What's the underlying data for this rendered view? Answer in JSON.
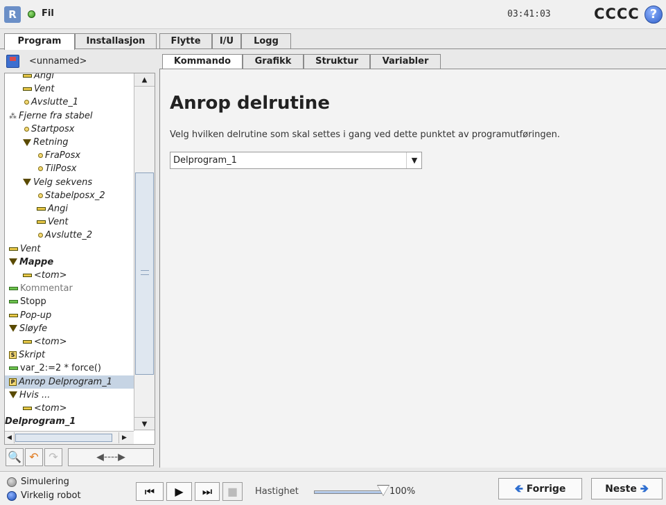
{
  "header": {
    "logo_text": "R",
    "file_menu": "Fil",
    "time": "03:41:03",
    "robot_name": "CCCC",
    "help_glyph": "?"
  },
  "main_tabs": [
    {
      "label": "Program",
      "active": true
    },
    {
      "label": "Installasjon",
      "active": false
    },
    {
      "label": "Flytte",
      "active": false
    },
    {
      "label": "I/U",
      "active": false
    },
    {
      "label": "Logg",
      "active": false
    }
  ],
  "program": {
    "name": "<unnamed>"
  },
  "tree": [
    {
      "label": "Angi",
      "icon": "bar-icon",
      "italic": true
    },
    {
      "label": "Vent",
      "icon": "bar-icon",
      "italic": true
    },
    {
      "label": "Avslutte_1",
      "icon": "waypoint-icon",
      "italic": true
    },
    {
      "label": "Fjerne fra stabel",
      "icon": "stack-icon",
      "italic": true
    },
    {
      "label": "Startposx",
      "icon": "waypoint-icon",
      "italic": true
    },
    {
      "label": "Retning",
      "icon": "folder-triangle-icon",
      "italic": true
    },
    {
      "label": "FraPosx",
      "icon": "waypoint-icon",
      "italic": true
    },
    {
      "label": "TilPosx",
      "icon": "waypoint-icon",
      "italic": true
    },
    {
      "label": "Velg sekvens",
      "icon": "folder-triangle-icon",
      "italic": true
    },
    {
      "label": "Stabelposx_2",
      "icon": "waypoint-icon",
      "italic": true
    },
    {
      "label": "Angi",
      "icon": "bar-icon",
      "italic": true
    },
    {
      "label": "Vent",
      "icon": "bar-icon",
      "italic": true
    },
    {
      "label": "Avslutte_2",
      "icon": "waypoint-icon",
      "italic": true
    },
    {
      "label": "Vent",
      "icon": "bar-icon",
      "italic": true
    },
    {
      "label": "Mappe",
      "icon": "folder-triangle-icon",
      "italic": true,
      "bold": true
    },
    {
      "label": "<tom>",
      "icon": "bar-icon",
      "italic": true
    },
    {
      "label": "Kommentar",
      "icon": "comment-icon",
      "grey": true
    },
    {
      "label": "Stopp",
      "icon": "stop-bar-icon"
    },
    {
      "label": "Pop-up",
      "icon": "bar-icon",
      "italic": true
    },
    {
      "label": "Sløyfe",
      "icon": "folder-triangle-icon",
      "italic": true
    },
    {
      "label": "<tom>",
      "icon": "bar-icon",
      "italic": true
    },
    {
      "label": "Skript",
      "icon": "script-icon",
      "italic": true
    },
    {
      "label": "var_2:=2 * force()",
      "icon": "assignment-icon"
    },
    {
      "label": "Anrop Delprogram_1",
      "icon": "call-icon",
      "italic": true,
      "selected": true
    },
    {
      "label": "Hvis ...",
      "icon": "folder-triangle-icon",
      "italic": true
    },
    {
      "label": "<tom>",
      "icon": "bar-icon",
      "italic": true
    },
    {
      "label": "Delprogram_1",
      "icon": "none",
      "italic": true,
      "bold": true
    }
  ],
  "left_toolbar": {
    "search_glyph": "🔍",
    "undo_glyph": "↶",
    "redo_glyph": "↷",
    "move_glyph": "◀----▶"
  },
  "sub_tabs": [
    {
      "label": "Kommando",
      "active": true
    },
    {
      "label": "Grafikk",
      "active": false
    },
    {
      "label": "Struktur",
      "active": false
    },
    {
      "label": "Variabler",
      "active": false
    }
  ],
  "command": {
    "title": "Anrop delrutine",
    "description": "Velg hvilken delrutine som skal settes i gang ved dette punktet av programutføringen.",
    "selected_subprogram": "Delprogram_1"
  },
  "footer": {
    "mode_simulation": "Simulering",
    "mode_real": "Virkelig robot",
    "speed_label": "Hastighet",
    "speed_value": "100%",
    "speed_fraction": 1.0,
    "prev_label": "Forrige",
    "next_label": "Neste"
  }
}
